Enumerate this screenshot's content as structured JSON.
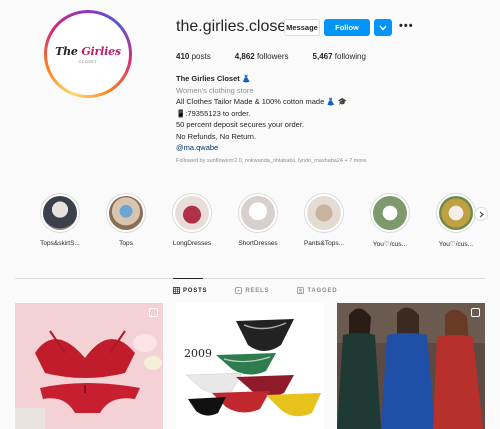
{
  "profile": {
    "username": "the.girlies.closet",
    "logo_text_a": "The ",
    "logo_text_b": "Girlies",
    "logo_text_c": " Closet",
    "logo_sub": "CLOSET",
    "message_label": "Message",
    "follow_label": "Follow",
    "dropdown_icon": "chevron-down",
    "more_label": "•••"
  },
  "stats": {
    "posts_count": "410",
    "posts_label": " posts",
    "followers_count": "4,862",
    "followers_label": " followers",
    "following_count": "5,467",
    "following_label": " following"
  },
  "bio": {
    "name": "The Girlies Closet",
    "name_emoji": "👗",
    "category": "Women's clothing store",
    "line1": "All Clothes Tailor Made & 100% cotton made",
    "line1_emoji_a": "👗",
    "line1_emoji_b": "🎓",
    "line2": "📱:79355123 to order.",
    "line3": "50 percent deposit secures your order.",
    "line4": "No Refunds, No Return.",
    "link": "@ma.qwabe",
    "followed_by": "Followed by sunflowerrr2.0, nokwanda_nhlabatsi, lyndo_mashaba24 + 7 more"
  },
  "highlights": [
    {
      "label": "Tops&skirtS...",
      "color": "#6a7a8a"
    },
    {
      "label": "Tops",
      "color": "#8a6d55"
    },
    {
      "label": "LongDresses",
      "color": "#b0304a"
    },
    {
      "label": "ShortDresses",
      "color": "#d8d0cc"
    },
    {
      "label": "Pants&Tops...",
      "color": "#b9a28c"
    },
    {
      "label": "You♡/cus...",
      "color": "#7c9a6c"
    },
    {
      "label": "You♡/cus...",
      "color": "#c0a040"
    }
  ],
  "tabs": [
    {
      "label": "POSTS",
      "icon": "grid-icon",
      "active": true
    },
    {
      "label": "REELS",
      "icon": "reels-icon",
      "active": false
    },
    {
      "label": "TAGGED",
      "icon": "tag-icon",
      "active": false
    }
  ],
  "posts": [
    {
      "overlay_text": ""
    },
    {
      "overlay_text": "2009"
    },
    {
      "overlay_text": ""
    }
  ]
}
